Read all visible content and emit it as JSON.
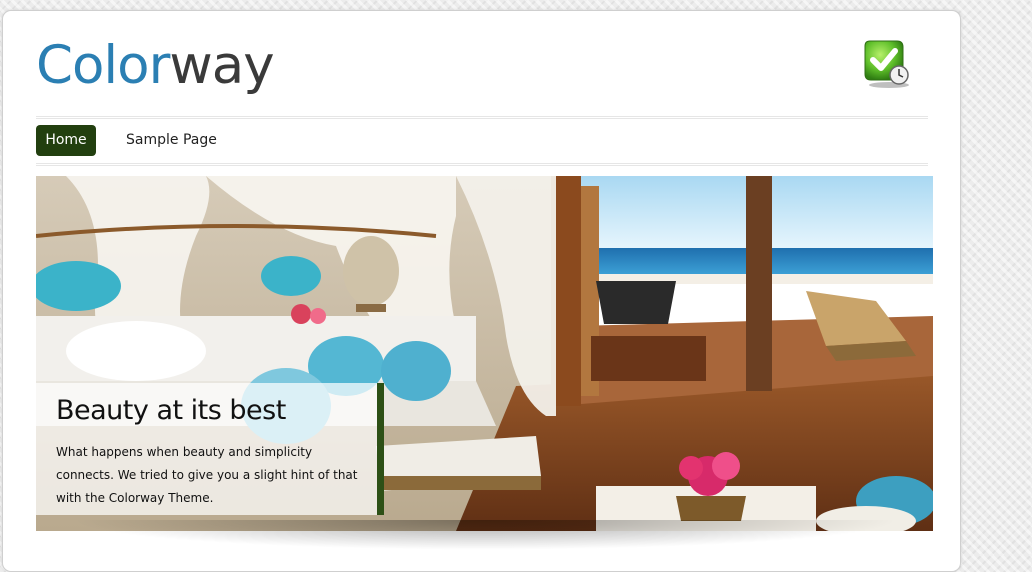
{
  "logo": {
    "part1": "Color",
    "part2": "way"
  },
  "badge": {
    "icon": "check-clock-icon"
  },
  "nav": {
    "items": [
      {
        "label": "Home"
      },
      {
        "label": "Sample Page"
      }
    ]
  },
  "slider": {
    "title": "Beauty at its best",
    "text": "What happens when beauty and simplicity connects. We tried to give you a slight hint of that with the Colorway Theme."
  },
  "colors": {
    "accent": "#223f0f",
    "logo_blue": "#2b7fb3"
  }
}
